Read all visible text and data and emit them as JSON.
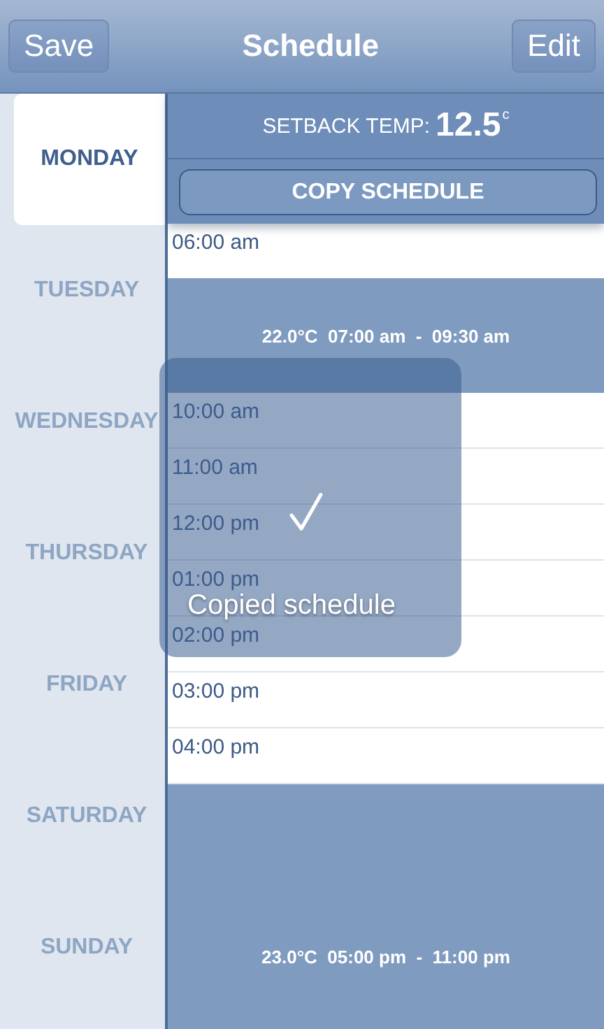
{
  "nav_bar": {
    "left_button": "Save",
    "title": "Schedule",
    "right_button": "Edit"
  },
  "days": [
    {
      "label": "MONDAY",
      "selected": true
    },
    {
      "label": "TUESDAY",
      "selected": false
    },
    {
      "label": "WEDNESDAY",
      "selected": false
    },
    {
      "label": "THURSDAY",
      "selected": false
    },
    {
      "label": "FRIDAY",
      "selected": false
    },
    {
      "label": "SATURDAY",
      "selected": false
    },
    {
      "label": "SUNDAY",
      "selected": false
    }
  ],
  "setback": {
    "label": "SETBACK TEMP:",
    "value": "12.5",
    "unit": "c"
  },
  "copy_button": "COPY SCHEDULE",
  "schedule": [
    {
      "kind": "slot",
      "time": "06:00 am"
    },
    {
      "kind": "block",
      "text": "22.0°C  07:00 am  -  09:30 am"
    },
    {
      "kind": "slot",
      "time": "10:00 am"
    },
    {
      "kind": "slot",
      "time": "11:00 am"
    },
    {
      "kind": "slot",
      "time": "12:00 pm"
    },
    {
      "kind": "slot",
      "time": "01:00 pm"
    },
    {
      "kind": "slot",
      "time": "02:00 pm"
    },
    {
      "kind": "slot",
      "time": "03:00 pm"
    },
    {
      "kind": "slot",
      "time": "04:00 pm"
    },
    {
      "kind": "block",
      "text": "23.0°C  05:00 pm  -  11:00 pm"
    }
  ],
  "toast": {
    "message": "Copied schedule"
  }
}
